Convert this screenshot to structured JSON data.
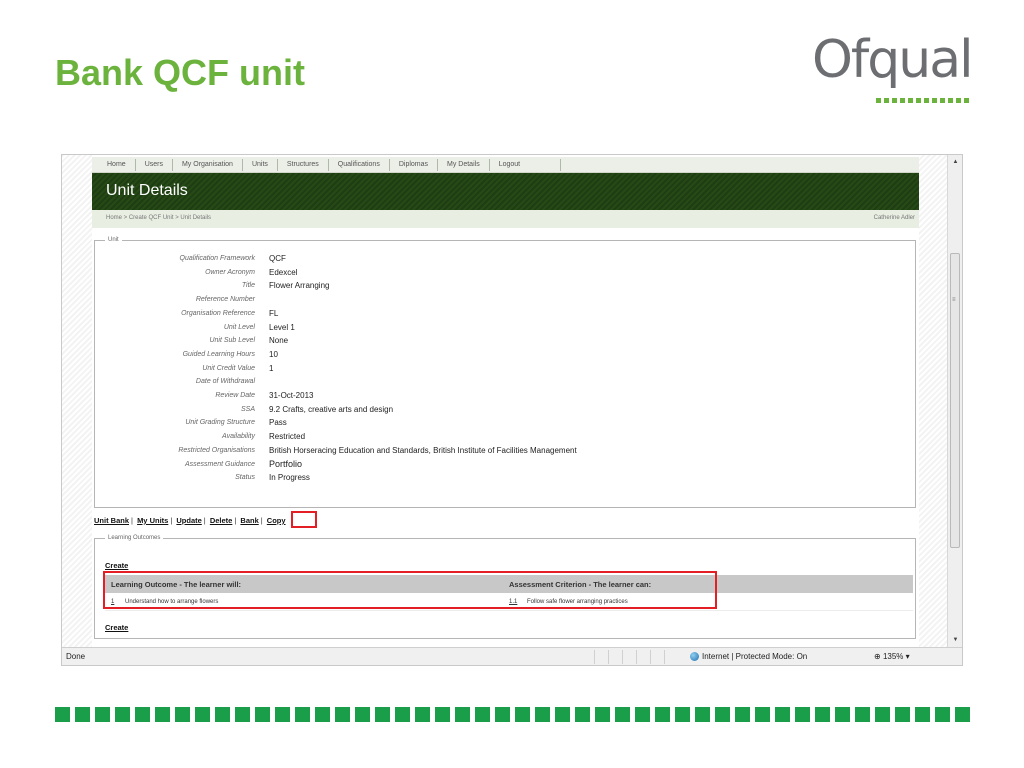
{
  "slide": {
    "title": "Bank QCF unit",
    "logo_text": "Ofqual",
    "brand_color": "#6cb33e",
    "footer_color": "#1b9e4a"
  },
  "nav": {
    "items": [
      "Home",
      "Users",
      "My Organisation",
      "Units",
      "Structures",
      "Qualifications",
      "Diplomas",
      "My Details",
      "Logout"
    ]
  },
  "page": {
    "title": "Unit Details",
    "breadcrumb": "Home > Create QCF Unit > Unit Details",
    "user": "Catherine Adler"
  },
  "unit": {
    "legend": "Unit",
    "fields": [
      {
        "label": "Qualification Framework",
        "value": "QCF"
      },
      {
        "label": "Owner Acronym",
        "value": "Edexcel"
      },
      {
        "label": "Title",
        "value": "Flower Arranging"
      },
      {
        "label": "Reference Number",
        "value": ""
      },
      {
        "label": "Organisation Reference",
        "value": "FL"
      },
      {
        "label": "Unit Level",
        "value": "Level 1"
      },
      {
        "label": "Unit Sub Level",
        "value": "None"
      },
      {
        "label": "Guided Learning Hours",
        "value": "10"
      },
      {
        "label": "Unit Credit Value",
        "value": "1"
      },
      {
        "label": "Date of Withdrawal",
        "value": ""
      },
      {
        "label": "Review Date",
        "value": "31-Oct-2013"
      },
      {
        "label": "SSA",
        "value": "9.2 Crafts, creative arts and design"
      },
      {
        "label": "Unit Grading Structure",
        "value": "Pass"
      },
      {
        "label": "Availability",
        "value": "Restricted"
      },
      {
        "label": "Restricted Organisations",
        "value": "British Horseracing Education and Standards, British Institute of Facilities Management"
      },
      {
        "label": "Assessment Guidance",
        "value": "Portfolio"
      },
      {
        "label": "Status",
        "value": "In Progress"
      }
    ]
  },
  "actions": {
    "unit_bank": "Unit Bank",
    "my_units": "My Units",
    "update": "Update",
    "delete": "Delete",
    "bank": "Bank",
    "copy": "Copy",
    "separator": "|"
  },
  "learning_outcomes": {
    "legend": "Learning Outcomes",
    "create": "Create",
    "col_outcome": "Learning Outcome - The learner will:",
    "col_criterion": "Assessment Criterion - The learner can:",
    "rows": [
      {
        "num": "1",
        "outcome": "Understand how to arrange flowers",
        "crit_num": "1.1",
        "criterion": "Follow safe flower arranging practices"
      }
    ]
  },
  "statusbar": {
    "left": "Done",
    "zone": "Internet | Protected Mode: On",
    "zoom": "135%"
  }
}
